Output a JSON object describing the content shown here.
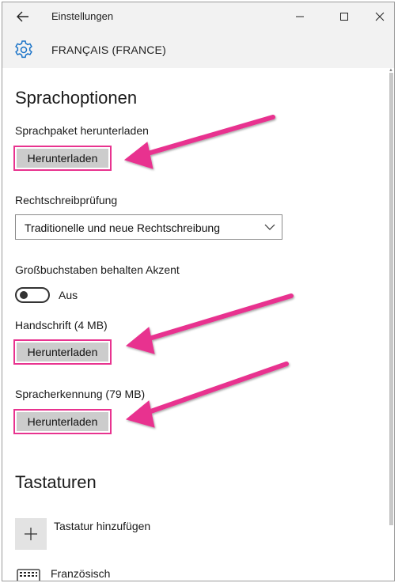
{
  "window": {
    "title": "Einstellungen",
    "controls": {
      "minimize": "minimize",
      "maximize": "maximize",
      "close": "close"
    }
  },
  "header": {
    "language": "FRANÇAIS (FRANCE)",
    "icon": "gear-icon"
  },
  "language_options": {
    "heading": "Sprachoptionen",
    "language_pack": {
      "label": "Sprachpaket herunterladen",
      "button": "Herunterladen"
    },
    "spell_check": {
      "label": "Rechtschreibprüfung",
      "selected": "Traditionelle und neue Rechtschreibung"
    },
    "accent": {
      "label": "Großbuchstaben behalten Akzent",
      "toggle_state": "Aus",
      "toggle_on": false
    },
    "handwriting": {
      "label": "Handschrift (4 MB)",
      "button": "Herunterladen"
    },
    "speech": {
      "label": "Spracherkennung (79 MB)",
      "button": "Herunterladen"
    }
  },
  "keyboards": {
    "heading": "Tastaturen",
    "add_label": "Tastatur hinzufügen",
    "items": [
      {
        "label": "Französisch",
        "icon": "keyboard-icon"
      }
    ]
  },
  "colors": {
    "highlight": "#e8338f",
    "button_fill": "#cccccc",
    "header_bg": "#f2f2f2",
    "accent_icon": "#1a73c8"
  }
}
